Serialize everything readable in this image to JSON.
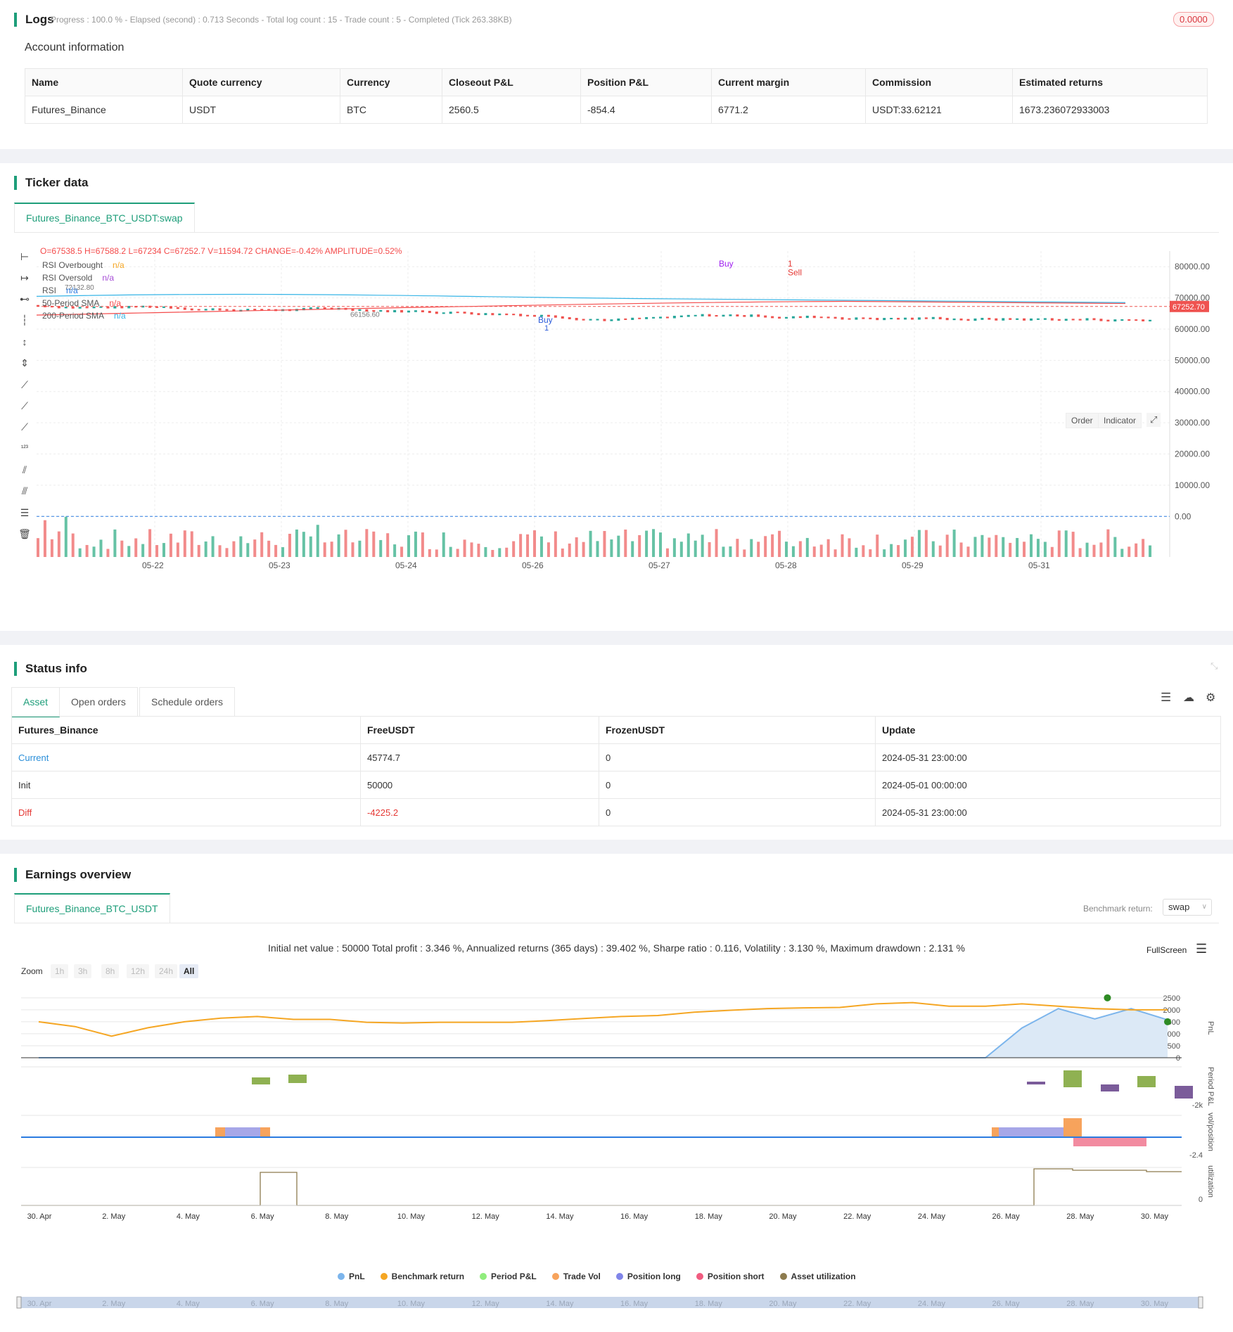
{
  "logs": {
    "title": "Logs",
    "status": "Progress : 100.0 % - Elapsed (second) : 0.713  Seconds - Total log count : 15 - Trade count : 5 - Completed (Tick 263.38KB)",
    "badge": "0.0000",
    "account_title": "Account information"
  },
  "account": {
    "headers": [
      "Name",
      "Quote currency",
      "Currency",
      "Closeout P&L",
      "Position P&L",
      "Current margin",
      "Commission",
      "Estimated returns"
    ],
    "row": [
      "Futures_Binance",
      "USDT",
      "BTC",
      "2560.5",
      "-854.4",
      "6771.2",
      "USDT:33.62121",
      "1673.236072933003"
    ]
  },
  "ticker": {
    "title": "Ticker data",
    "tab": "Futures_Binance_BTC_USDT:swap",
    "ohlc": "O=67538.5 H=67588.2 L=67234 C=67252.7 V=11594.72 CHANGE=-0.42% AMPLITUDE=0.52%",
    "legend": [
      {
        "name": "RSI Overbought",
        "value": "n/a",
        "color": "#f5a623"
      },
      {
        "name": "RSI Oversold",
        "value": "n/a",
        "color": "#a64dd6"
      },
      {
        "name": "RSI",
        "value": "n/a",
        "color": "#2b7be0"
      },
      {
        "name": "50-Period SMA",
        "value": "n/a",
        "color": "#f44b4b"
      },
      {
        "name": "200-Period SMA",
        "value": "n/a",
        "color": "#36b4e6"
      }
    ],
    "buttons": [
      "Order",
      "Indicator"
    ],
    "price_ticks": [
      "80000.00",
      "70000.00",
      "60000.00",
      "50000.00",
      "40000.00",
      "30000.00",
      "20000.00",
      "10000.00",
      "0.00"
    ],
    "last_price": "67252.70",
    "dates": [
      "05-22",
      "05-23",
      "05-24",
      "05-26",
      "05-27",
      "05-28",
      "05-29",
      "05-31"
    ],
    "marks": {
      "high": "72132.80",
      "low": "66156.60",
      "buy1": "Buy",
      "buy1n": "1",
      "buy2": "Buy",
      "sell": "Sell",
      "selln": "1"
    }
  },
  "status": {
    "title": "Status info",
    "tabs": [
      "Asset",
      "Open orders",
      "Schedule orders"
    ],
    "headers": [
      "Futures_Binance",
      "FreeUSDT",
      "FrozenUSDT",
      "Update"
    ],
    "rows": [
      [
        "Current",
        "45774.7",
        "0",
        "2024-05-31 23:00:00"
      ],
      [
        "Init",
        "50000",
        "0",
        "2024-05-01 00:00:00"
      ],
      [
        "Diff",
        "-4225.2",
        "0",
        "2024-05-31 23:00:00"
      ]
    ]
  },
  "earnings": {
    "title": "Earnings overview",
    "tab": "Futures_Binance_BTC_USDT",
    "bench_label": "Benchmark return:",
    "bench_value": "swap",
    "summary": "Initial net value : 50000 Total profit : 3.346 %, Annualized returns (365 days) : 39.402 %, Sharpe ratio : 0.116, Volatility : 3.130 %, Maximum drawdown : 2.131 %",
    "fullscreen": "FullScreen",
    "zoom_label": "Zoom",
    "zoom": [
      "1h",
      "3h",
      "8h",
      "12h",
      "24h",
      "All"
    ],
    "pnl_ticks": [
      "2500",
      "2000",
      "1500",
      "1000",
      "500",
      "0"
    ],
    "axis_labels": [
      "PnL",
      "Period P&L",
      "vol/position",
      "utilization"
    ],
    "period_tick": "-2k",
    "vol_tick": "-2.4",
    "util_tick": "0",
    "dates": [
      "30. Apr",
      "2. May",
      "4. May",
      "6. May",
      "8. May",
      "10. May",
      "12. May",
      "14. May",
      "16. May",
      "18. May",
      "20. May",
      "22. May",
      "24. May",
      "26. May",
      "28. May",
      "30. May"
    ],
    "legend": [
      {
        "name": "PnL",
        "color": "#7cb5ec"
      },
      {
        "name": "Benchmark return",
        "color": "#f5a623"
      },
      {
        "name": "Period P&L",
        "color": "#90ed7d"
      },
      {
        "name": "Trade Vol",
        "color": "#f7a35c"
      },
      {
        "name": "Position long",
        "color": "#8085e9"
      },
      {
        "name": "Position short",
        "color": "#f15c80"
      },
      {
        "name": "Asset utilization",
        "color": "#8d7b4e"
      }
    ]
  },
  "chart_data": {
    "type": "line",
    "series": [
      {
        "name": "PnL",
        "values": [
          0,
          0,
          0,
          0,
          0,
          0,
          0,
          0,
          0,
          0,
          0,
          0,
          0,
          0,
          0,
          0,
          0,
          0,
          0,
          0,
          0,
          0,
          0,
          0,
          0,
          0,
          0,
          1240,
          2050,
          1620,
          2050,
          1580
        ]
      },
      {
        "name": "Benchmark return",
        "values": [
          1500,
          1300,
          900,
          1250,
          1500,
          1650,
          1720,
          1600,
          1600,
          1480,
          1450,
          1480,
          1480,
          1480,
          1550,
          1640,
          1720,
          1760,
          1900,
          1980,
          2050,
          2080,
          2100,
          2250,
          2300,
          2150,
          2150,
          2250,
          2150,
          2050,
          2000,
          2000
        ]
      }
    ]
  }
}
